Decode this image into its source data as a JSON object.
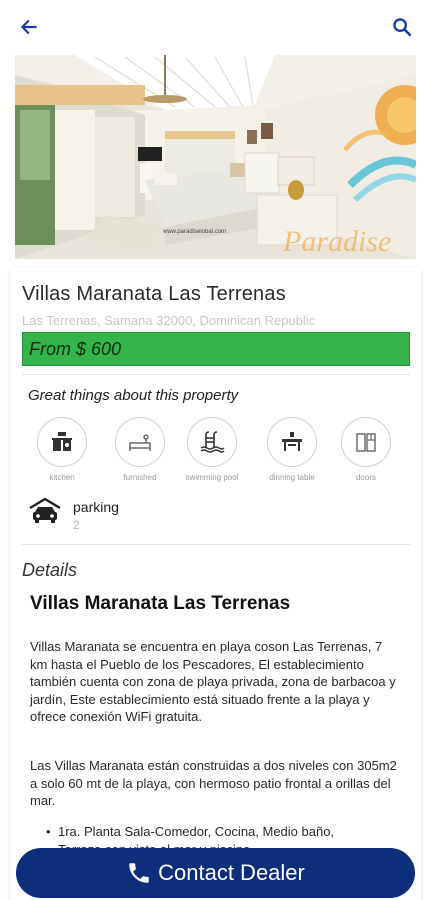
{
  "header": {
    "back_icon": "arrow-left-icon",
    "search_icon": "search-icon",
    "accent": "#1c3aa9"
  },
  "hero": {
    "watermark": "www.paradiselobal.com",
    "logo_text": "Paradise"
  },
  "listing": {
    "title": "Villas Maranata Las Terrenas",
    "address": "Las Terrenas, Samana 32000, Dominican Republic",
    "price": "From $ 600",
    "price_color": "#34b449"
  },
  "amenities": {
    "heading": "Great things about this property",
    "items": [
      {
        "label": "kitchen",
        "icon": "kitchen-icon"
      },
      {
        "label": "furnished",
        "icon": "furnished-icon"
      },
      {
        "label": "swimming pool",
        "icon": "swimming-pool-icon"
      },
      {
        "label": "dinning table",
        "icon": "dining-table-icon"
      },
      {
        "label": "doors",
        "icon": "doors-icon"
      }
    ],
    "parking": {
      "label": "parking",
      "value": "2",
      "icon": "car-icon"
    }
  },
  "details": {
    "heading": "Details",
    "title": "Villas Maranata Las Terrenas",
    "paragraph1": "Villas Maranata se encuentra en playa coson Las Terrenas, 7 km hasta el Pueblo de los Pescadores, El establecimiento también cuenta con zona de playa privada, zona de barbacoa y jardín, Este establecimiento está situado frente a la playa y ofrece conexión WiFi gratuita.",
    "paragraph2": "Las Villas Maranata están construidas a dos niveles con 305m2 a solo 60 mt de la playa, con hermoso patio frontal a orillas del mar.",
    "bullets": [
      "1ra. Planta Sala-Comedor, Cocina, Medio baño,",
      "Terraza con vista al mar y piscina"
    ]
  },
  "contact": {
    "label": "Contact Dealer",
    "icon": "phone-icon",
    "color": "#0d2e7b"
  }
}
